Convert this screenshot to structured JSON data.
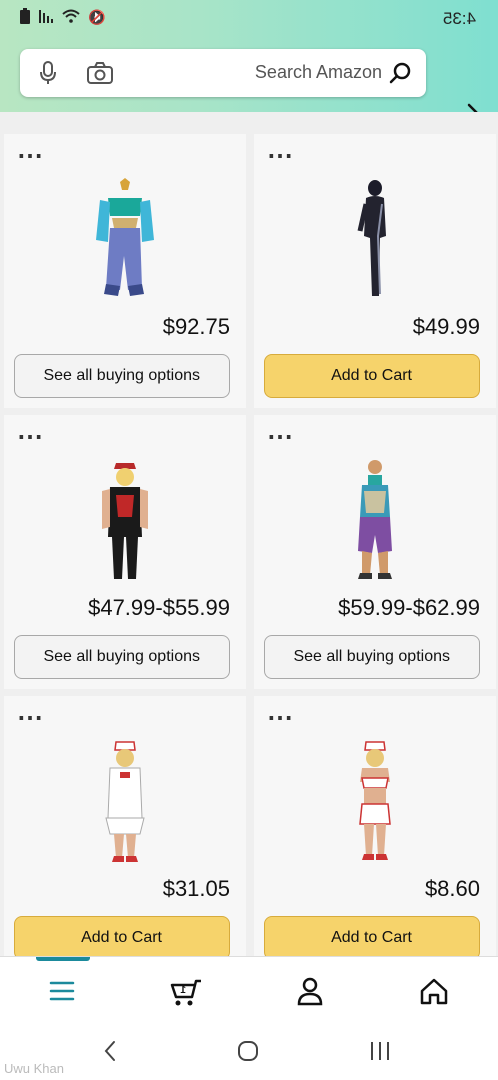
{
  "status": {
    "time": "4:35"
  },
  "search": {
    "placeholder": "Search Amazon"
  },
  "products": [
    {
      "price": "$49.99",
      "button": "Add to Cart",
      "button_type": "cart"
    },
    {
      "price": "$92.75",
      "button": "See all buying options",
      "button_type": "options"
    },
    {
      "price": "$59.99-$62.99",
      "button": "See all buying options",
      "button_type": "options"
    },
    {
      "price": "$47.99-$55.99",
      "button": "See all buying options",
      "button_type": "options"
    },
    {
      "price": "$8.60",
      "button": "Add to Cart",
      "button_type": "cart"
    },
    {
      "price": "$31.05",
      "button": "Add to Cart",
      "button_type": "cart"
    }
  ],
  "bottom_nav": [
    "home-icon",
    "account-icon",
    "cart-icon",
    "menu-icon"
  ],
  "colors": {
    "accent": "#1b8a9c",
    "cart_button": "#f6d36b",
    "header": "#8fe0cc"
  },
  "watermark": "Uwu Khan"
}
